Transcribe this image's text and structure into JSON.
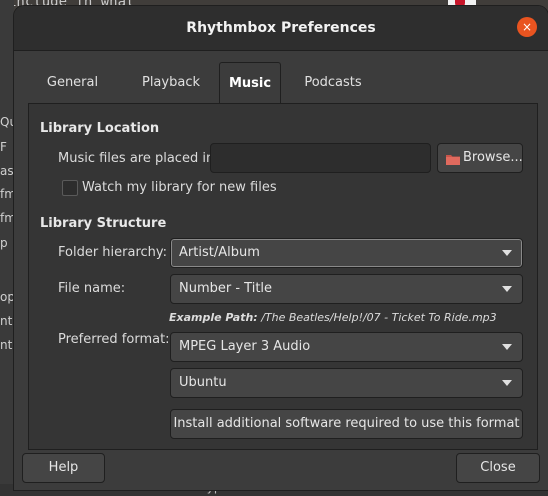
{
  "background": {
    "top_text": "include in what",
    "sidebar_items": [
      "Qu",
      "F",
      "ast",
      "fm",
      "fm",
      "p",
      "op",
      "ntl",
      "ntl"
    ],
    "bottom_text": "mimetypes"
  },
  "window": {
    "title": "Rhythmbox Preferences",
    "close_icon": "×"
  },
  "tabs": [
    {
      "label": "General",
      "active": false
    },
    {
      "label": "Playback",
      "active": false
    },
    {
      "label": "Music",
      "active": true
    },
    {
      "label": "Podcasts",
      "active": false
    }
  ],
  "library_location": {
    "title": "Library Location",
    "music_files_label": "Music files are placed in:",
    "music_files_value": "",
    "browse_label": "Browse...",
    "watch_label": "Watch my library for new files",
    "watch_checked": false
  },
  "library_structure": {
    "title": "Library Structure",
    "folder_label": "Folder hierarchy:",
    "folder_value": "Artist/Album",
    "filename_label": "File name:",
    "filename_value": "Number - Title",
    "example_prefix": "Example Path:",
    "example_path": "/The Beatles/Help!/07 - Ticket To Ride.mp3",
    "format_label": "Preferred format:",
    "format_value": "MPEG Layer 3 Audio",
    "profile_value": "Ubuntu",
    "install_label": "Install additional software required to use this format"
  },
  "footer": {
    "help_label": "Help",
    "close_label": "Close"
  },
  "colors": {
    "accent": "#e95420",
    "window_bg": "#3c3c3c",
    "titlebar_bg": "#2e2e2e"
  }
}
